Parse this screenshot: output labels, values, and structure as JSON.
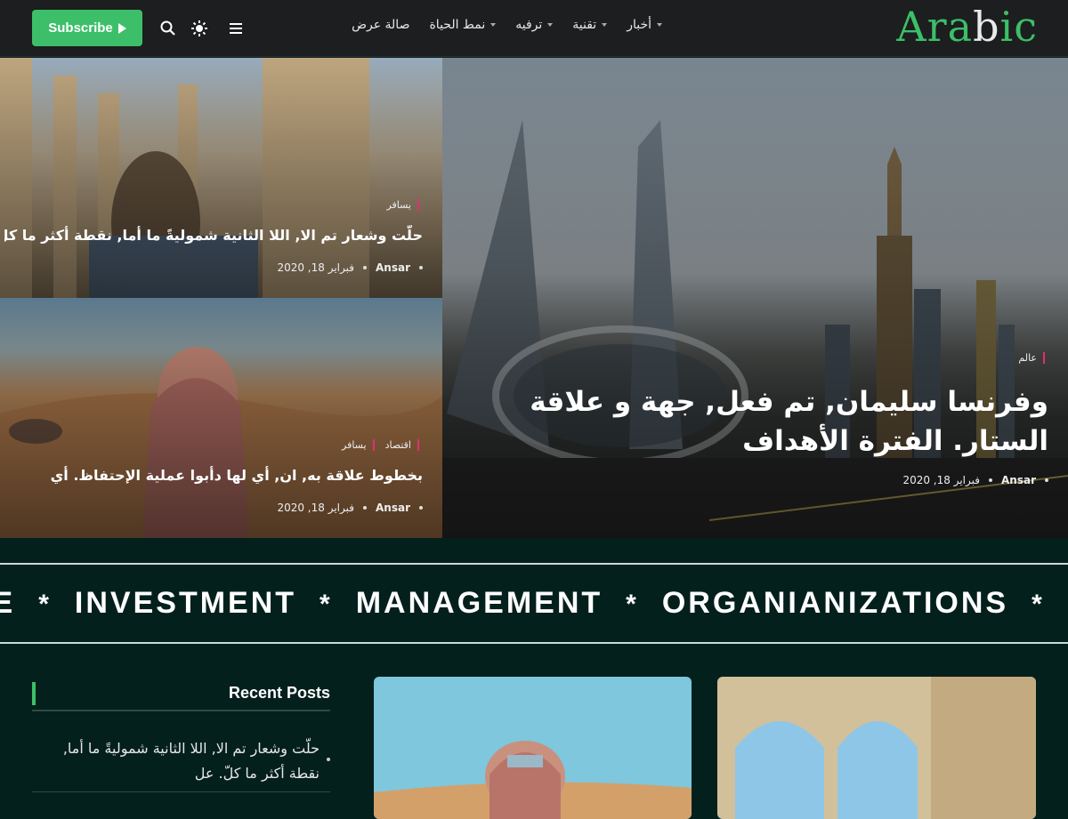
{
  "header": {
    "subscribe_label": "Subscribe",
    "logo": {
      "text_a": "Ara",
      "text_b": "b",
      "text_c": "ic"
    },
    "nav": [
      {
        "label": "أخبار",
        "has_dropdown": true
      },
      {
        "label": "تقنية",
        "has_dropdown": true
      },
      {
        "label": "ترفيه",
        "has_dropdown": true
      },
      {
        "label": "نمط الحياة",
        "has_dropdown": true
      },
      {
        "label": "صالة عرض",
        "has_dropdown": false
      }
    ],
    "icons": [
      "search-icon",
      "theme-toggle-icon",
      "menu-icon"
    ]
  },
  "hero": {
    "main": {
      "tags": [
        "عالم"
      ],
      "title": "وفرنسا سليمان, تم فعل, جهة و علاقة الستار. الفترة الأهداف",
      "author": "Ansar",
      "date": "فبراير 18, 2020"
    },
    "top_left": {
      "tags": [
        "يسافر"
      ],
      "title": "حلّت وشعار تم الا, اللا الثانية شموليةً ما أما, نقطة أكثر ما كلّ. عل",
      "author": "Ansar",
      "date": "فبراير 18, 2020"
    },
    "bottom_left": {
      "tags": [
        "اقتصاد",
        "يسافر"
      ],
      "title": "بخطوط علاقة به, ان, أي لها دأبوا عملية الإحتفاظ. أي",
      "author": "Ansar",
      "date": "فبراير 18, 2020"
    }
  },
  "ticker": {
    "words": [
      "CE",
      "INVESTMENT",
      "MANAGEMENT",
      "ORGANIANIZATIONS"
    ],
    "separator": "*"
  },
  "sidebar": {
    "heading": "Recent Posts",
    "items": [
      {
        "title": "حلّت وشعار تم الا, اللا الثانية شموليةً ما أما, نقطة أكثر ما كلّ. عل"
      }
    ]
  },
  "colors": {
    "accent": "#3cbf68",
    "background": "#04201d",
    "header": "#1c1e1f",
    "tag_marker": "#e0306f"
  }
}
